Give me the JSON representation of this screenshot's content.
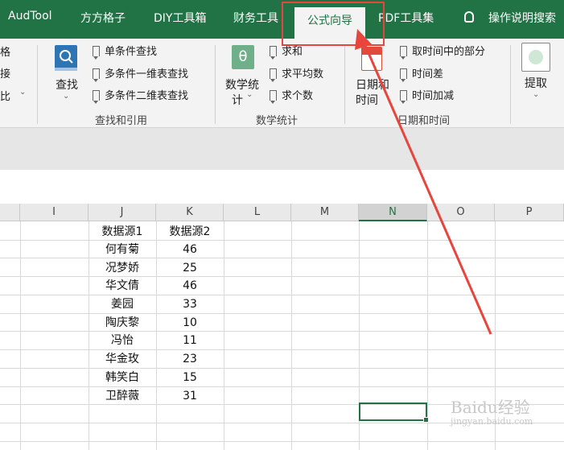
{
  "tabs": [
    {
      "label": "AudTool"
    },
    {
      "label": "方方格子"
    },
    {
      "label": "DIY工具箱"
    },
    {
      "label": "财务工具"
    },
    {
      "label": "公式向导"
    },
    {
      "label": "PDF工具集"
    }
  ],
  "help_label": "操作说明搜索",
  "ribbon": {
    "partial_left": [
      "格",
      "接",
      "比"
    ],
    "lookup_group": {
      "big_button": "查找",
      "items": [
        "单条件查找",
        "多条件一维表查找",
        "多条件二维表查找"
      ],
      "label": "查找和引用"
    },
    "math_group": {
      "big_button_line1": "数学统",
      "big_button_line2": "计",
      "big_icon_glyph": "θ",
      "items": [
        "求和",
        "求平均数",
        "求个数"
      ],
      "label": "数学统计"
    },
    "date_group": {
      "big_button_line1": "日期和",
      "big_button_line2": "时间",
      "items": [
        "取时间中的部分",
        "时间差",
        "时间加减"
      ],
      "label": "日期和时间"
    },
    "extract_button": "提取"
  },
  "columns": [
    "I",
    "J",
    "K",
    "L",
    "M",
    "N",
    "O",
    "P"
  ],
  "table": {
    "header": [
      "数据源1",
      "数据源2"
    ],
    "rows": [
      [
        "何有菊",
        "46"
      ],
      [
        "况梦娇",
        "25"
      ],
      [
        "华文倩",
        "46"
      ],
      [
        "姜园",
        "33"
      ],
      [
        "陶庆黎",
        "10"
      ],
      [
        "冯怡",
        "11"
      ],
      [
        "华金玫",
        "23"
      ],
      [
        "韩笑白",
        "15"
      ],
      [
        "卫醉薇",
        "31"
      ]
    ]
  },
  "watermark": {
    "title": "Baidu经验",
    "sub": "jingyan.baidu.com"
  },
  "colors": {
    "excel_green": "#217346",
    "annotation_red": "#e8453c"
  }
}
